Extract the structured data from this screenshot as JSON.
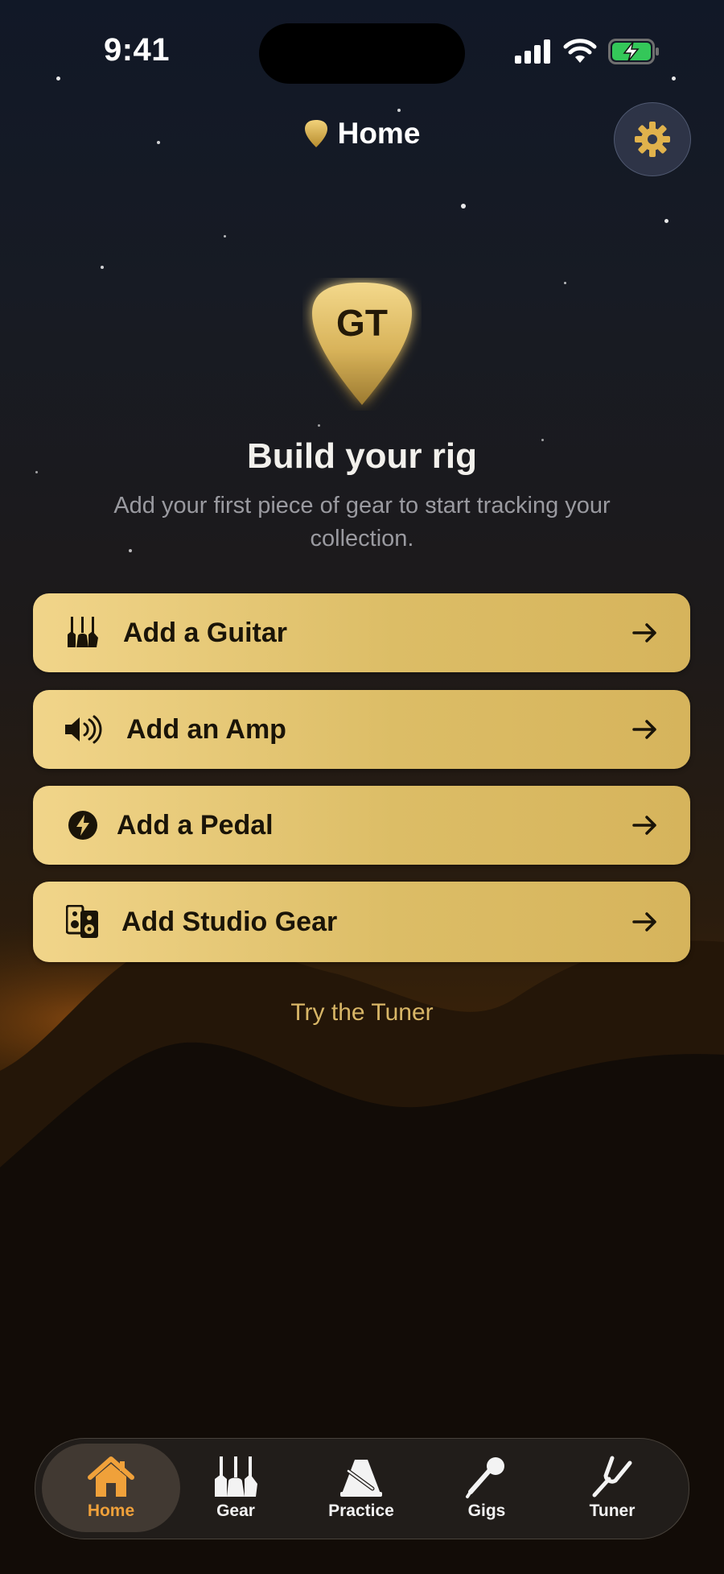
{
  "status_bar": {
    "time": "9:41"
  },
  "header": {
    "title": "Home"
  },
  "hero": {
    "logo_text": "GT",
    "title": "Build your rig",
    "subtitle_line1": "Add your first piece of gear to start tracking your",
    "subtitle_line2": "collection."
  },
  "actions": [
    {
      "label": "Add a Guitar",
      "icon": "guitars-icon"
    },
    {
      "label": "Add an Amp",
      "icon": "speaker-icon"
    },
    {
      "label": "Add a Pedal",
      "icon": "bolt-circle-icon"
    },
    {
      "label": "Add Studio Gear",
      "icon": "studio-speakers-icon"
    }
  ],
  "tuner_link": "Try the Tuner",
  "tabs": [
    {
      "label": "Home",
      "icon": "house-icon",
      "active": true
    },
    {
      "label": "Gear",
      "icon": "guitars-icon",
      "active": false
    },
    {
      "label": "Practice",
      "icon": "metronome-icon",
      "active": false
    },
    {
      "label": "Gigs",
      "icon": "microphone-icon",
      "active": false
    },
    {
      "label": "Tuner",
      "icon": "tuning-fork-icon",
      "active": false
    }
  ],
  "colors": {
    "accent_gold": "#dcbd66",
    "active_tab": "#f0a13a",
    "tuner_link": "#d8b667"
  }
}
